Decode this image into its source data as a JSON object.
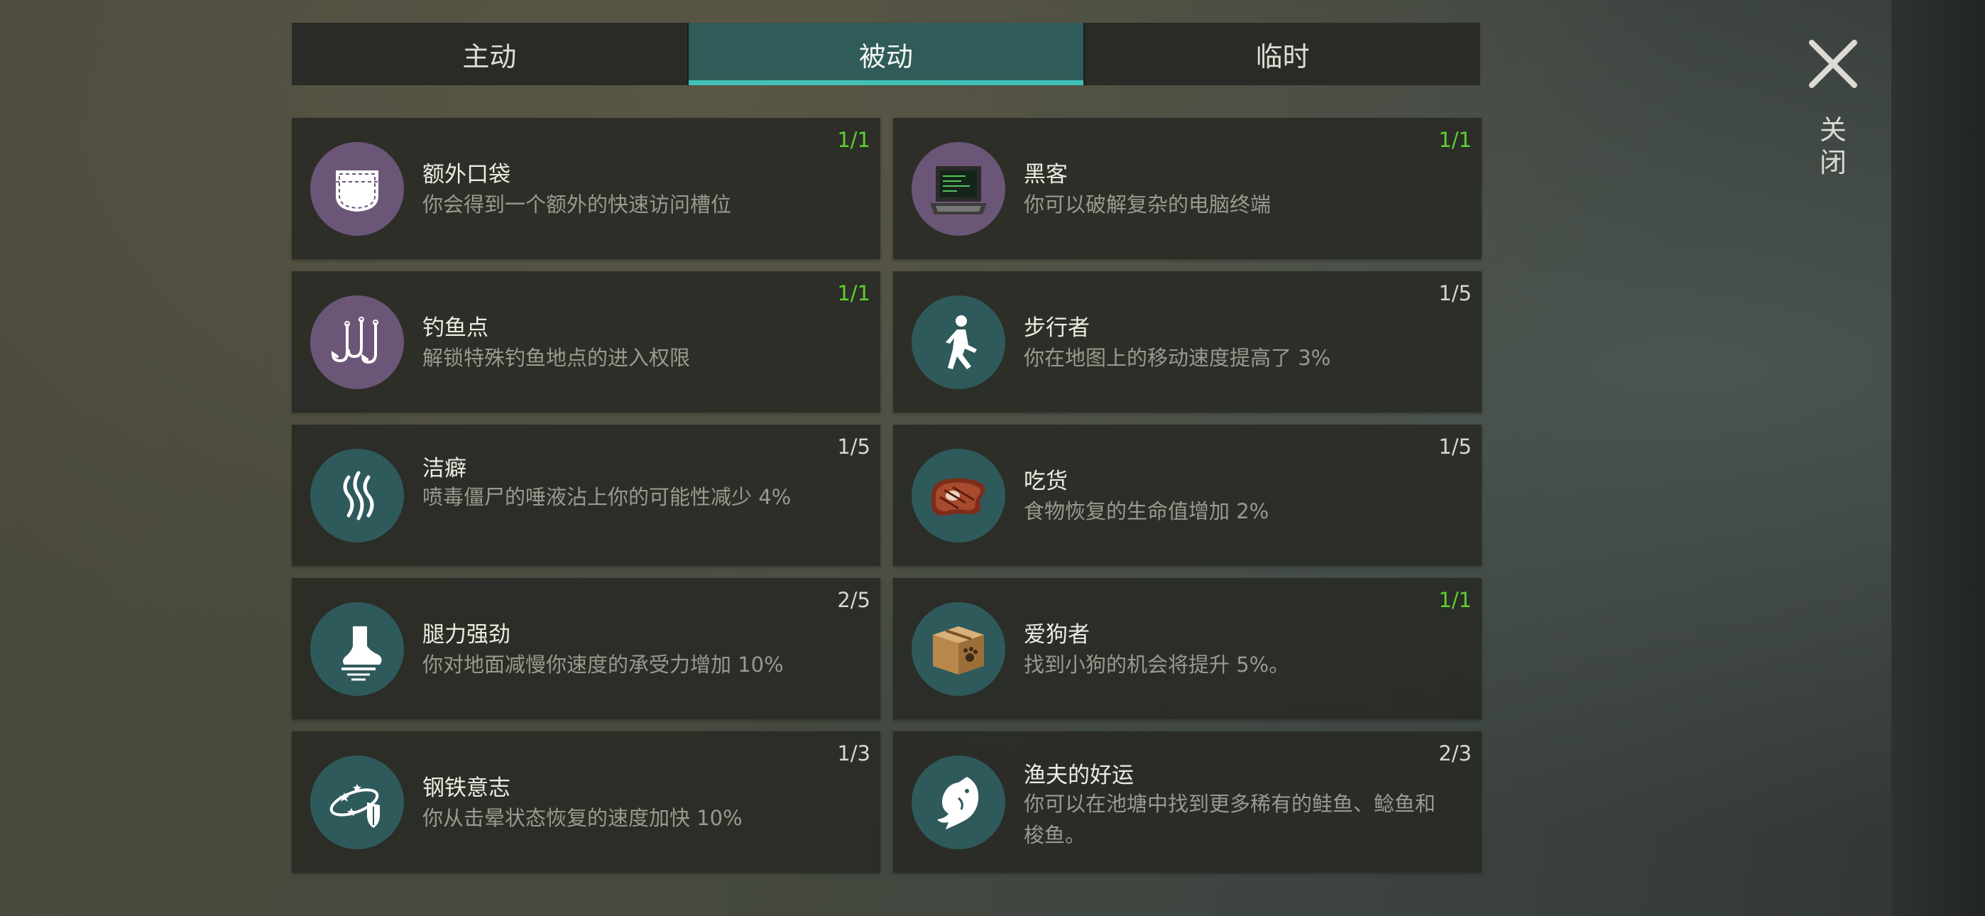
{
  "tabs": [
    {
      "label": "主动",
      "active": false
    },
    {
      "label": "被动",
      "active": true
    },
    {
      "label": "临时",
      "active": false
    }
  ],
  "close": {
    "label": "关闭",
    "icon": "close-x-icon"
  },
  "colors": {
    "accent": "#41c0b8",
    "max_level": "#5cd12f",
    "icon_purple": "#6c5678",
    "icon_teal": "#2f5a5c"
  },
  "skills": [
    {
      "title": "额外口袋",
      "desc": "你会得到一个额外的快速访问槽位",
      "level": "1/1",
      "icon": "pocket-icon"
    },
    {
      "title": "黑客",
      "desc": "你可以破解复杂的电脑终端",
      "level": "1/1",
      "icon": "computer-terminal-icon"
    },
    {
      "title": "钓鱼点",
      "desc": "解锁特殊钓鱼地点的进入权限",
      "level": "1/1",
      "icon": "fishing-hooks-icon"
    },
    {
      "title": "步行者",
      "desc": "你在地图上的移动速度提高了 3%",
      "level": "1/5",
      "icon": "walker-icon"
    },
    {
      "title": "洁癖",
      "desc": "喷毒僵尸的唾液沾上你的可能性减少 4%",
      "level": "1/5",
      "icon": "vapor-icon"
    },
    {
      "title": "吃货",
      "desc": "食物恢复的生命值增加 2%",
      "level": "1/5",
      "icon": "steak-icon"
    },
    {
      "title": "腿力强劲",
      "desc": "你对地面减慢你速度的承受力增加 10%",
      "level": "2/5",
      "icon": "strong-leg-icon"
    },
    {
      "title": "爱狗者",
      "desc": "找到小狗的机会将提升 5%。",
      "level": "1/1",
      "icon": "paw-box-icon"
    },
    {
      "title": "钢铁意志",
      "desc": "你从击晕状态恢复的速度加快 10%",
      "level": "1/3",
      "icon": "stun-shield-icon"
    },
    {
      "title": "渔夫的好运",
      "desc": "你可以在池塘中找到更多稀有的鲑鱼、鲶鱼和梭鱼。",
      "level": "2/3",
      "icon": "fish-icon"
    }
  ]
}
